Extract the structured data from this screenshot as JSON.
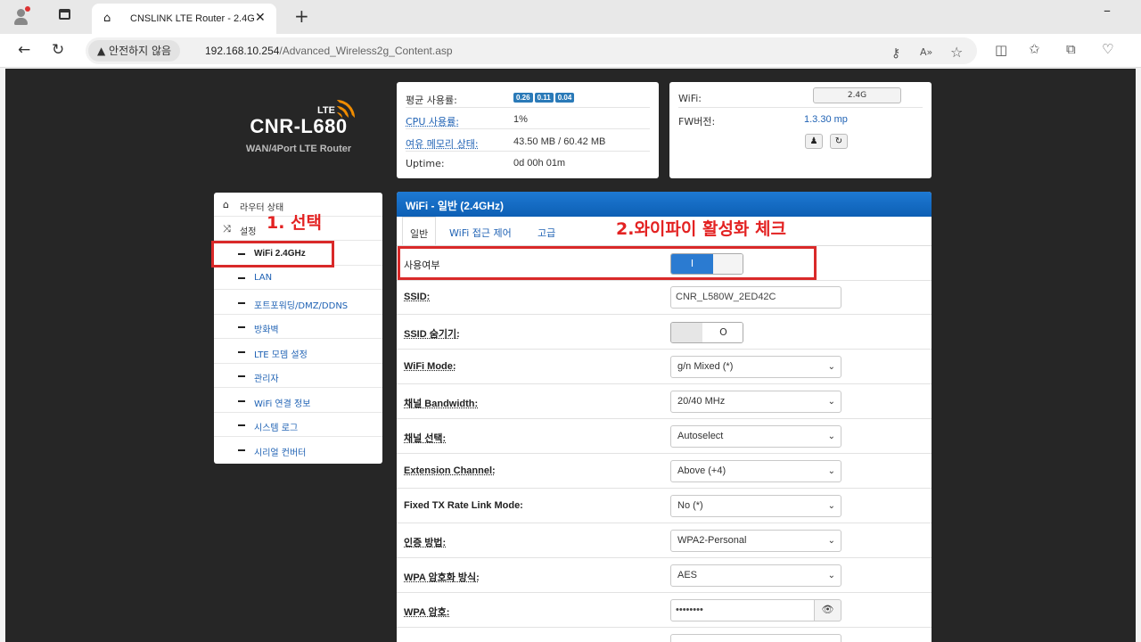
{
  "browser": {
    "tab_title": "CNSLINK LTE Router - 2.4G",
    "tab_close": "✕",
    "new_tab": "+",
    "minimize": "–",
    "security_warning": "안전하지 않음",
    "url_host": "192.168.10.254",
    "url_path": "/Advanced_Wireless2g_Content.asp"
  },
  "brand": {
    "lte": "LTE",
    "model": "CNR-L680",
    "subtitle": "WAN/4Port LTE Router"
  },
  "status": {
    "load_label": "평균 사용률:",
    "load_values": [
      "0.26",
      "0.11",
      "0.04"
    ],
    "cpu_label": "CPU 사용률:",
    "cpu_value": "1%",
    "mem_label": "여유 메모리 상태:",
    "mem_value": "43.50 MB / 60.42 MB",
    "uptime_label": "Uptime:",
    "uptime_value": "0d 00h 01m"
  },
  "wifi_status": {
    "wifi_label": "WiFi:",
    "wifi_button": "2.4G",
    "fw_label": "FW버전:",
    "fw_value": "1.3.30 mp"
  },
  "menu": {
    "router_status": "라우터 상태",
    "settings": "설정",
    "items": [
      "WiFi 2.4GHz",
      "LAN",
      "포트포워딩/DMZ/DDNS",
      "방화벽",
      "LTE 모뎀 설정",
      "관리자",
      "WiFi 연결 정보",
      "시스템 로그",
      "시리얼 컨버터"
    ]
  },
  "content": {
    "title": "WiFi - 일반 (2.4GHz)",
    "tabs": [
      "일반",
      "WiFi 접근 제어",
      "고급"
    ],
    "rows": {
      "enable_label": "사용여부",
      "enable_toggle_on": "I",
      "ssid_label": "SSID:",
      "ssid_value": "CNR_L580W_2ED42C",
      "hide_label": "SSID 숨기기:",
      "hide_toggle_off": "O",
      "mode_label": "WiFi Mode:",
      "mode_value": "g/n Mixed (*)",
      "bw_label": "채널 Bandwidth:",
      "bw_value": "20/40 MHz",
      "ch_label": "채널 선택:",
      "ch_value": "Autoselect",
      "ext_label": "Extension Channel:",
      "ext_value": "Above (+4)",
      "fixed_label": "Fixed TX Rate Link Mode:",
      "fixed_value": "No (*)",
      "auth_label": "인증 방법:",
      "auth_value": "WPA2-Personal",
      "enc_label": "WPA 암호화 방식:",
      "enc_value": "AES",
      "key_label": "WPA 암호:",
      "key_value": "••••••••"
    }
  },
  "annotations": {
    "step1": "1. 선택",
    "step2": "2.와이파이 활성화 체크",
    "color": "#e32222"
  }
}
